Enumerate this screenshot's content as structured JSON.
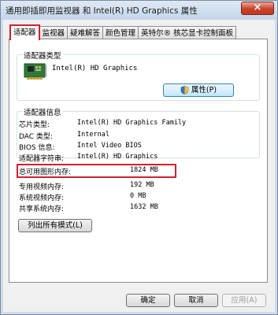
{
  "window": {
    "title": "通用即插即用监视器 和 Intel(R) HD Graphics 属性",
    "close_glyph": "×"
  },
  "tabs": [
    {
      "label": "适配器"
    },
    {
      "label": "监视器"
    },
    {
      "label": "疑难解答"
    },
    {
      "label": "颜色管理"
    },
    {
      "label": "英特尔® 核芯显卡控制面板"
    }
  ],
  "adapter_type": {
    "group_label": "适配器类型",
    "name": "Intel(R) HD Graphics",
    "icon": "graphics-card-icon",
    "properties_button": "属性(P)"
  },
  "adapter_info": {
    "group_label": "适配器信息",
    "rows": [
      {
        "label": "芯片类型:",
        "value": "Intel(R) HD Graphics Family"
      },
      {
        "label": "DAC 类型:",
        "value": "Internal"
      },
      {
        "label": "BIOS 信息:",
        "value": "Intel Video BIOS"
      },
      {
        "label": "适配器字符串:",
        "value": "Intel(R) HD Graphics"
      }
    ]
  },
  "memory": {
    "rows": [
      {
        "label": "总可用图形内存:",
        "value": "1824 MB"
      },
      {
        "label": "专用视频内存:",
        "value": "192 MB"
      },
      {
        "label": "系统视频内存:",
        "value": "0 MB"
      },
      {
        "label": "共享系统内存:",
        "value": "1632 MB"
      }
    ]
  },
  "list_modes_button": "列出所有模式(L)",
  "footer": {
    "ok": "确定",
    "cancel": "取消",
    "apply": "应用(A)"
  },
  "colors": {
    "highlight": "#d0202d",
    "window_frame": "#cfdcec"
  }
}
